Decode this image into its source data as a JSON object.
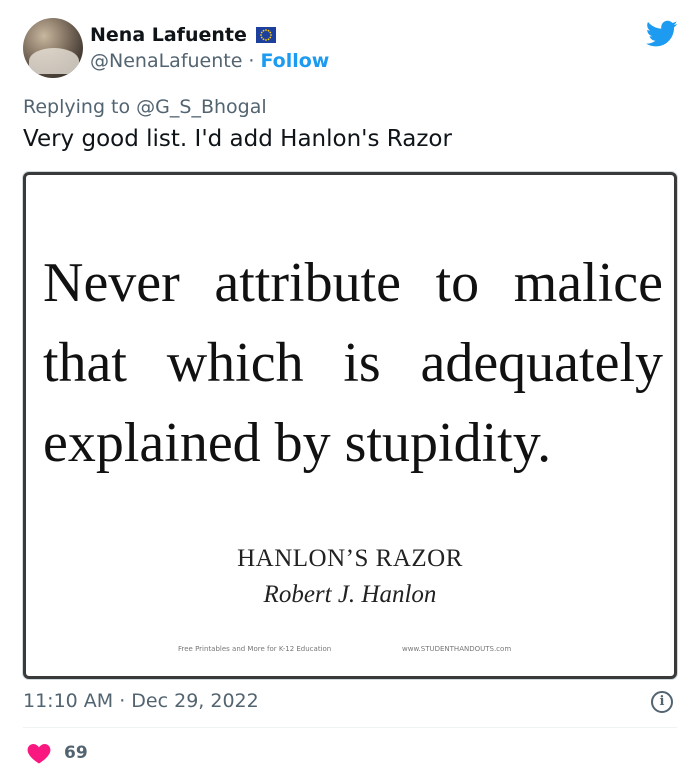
{
  "author": {
    "name": "Nena Lafuente",
    "handle": "@NenaLafuente",
    "separator": "·",
    "follow_label": "Follow",
    "flag_icon": "eu-flag-icon",
    "avatar": "avatar"
  },
  "header": {
    "brand_icon": "twitter-bird-icon",
    "brand_color": "#1d9bf0"
  },
  "reply": {
    "prefix": "Replying to",
    "mention": "@G_S_Bhogal"
  },
  "tweet": {
    "text": "Very good list. I'd add Hanlon's Razor"
  },
  "media": {
    "quote_lines": [
      "Never attribute to malice",
      "that which is adequately",
      "explained by stupidity."
    ],
    "title": "HANLON’S RAZOR",
    "author": "Robert J. Hanlon",
    "footer_left": "Free Printables and More for K-12 Education",
    "footer_right": "www.STUDENTHANDOUTS.com"
  },
  "meta": {
    "timestamp": "11:10 AM · Dec 29, 2022",
    "info_icon": "info-icon"
  },
  "actions": {
    "like_icon": "heart-icon",
    "like_color": "#f91880",
    "like_count": "69"
  }
}
